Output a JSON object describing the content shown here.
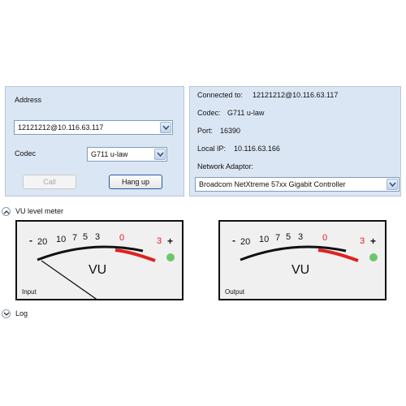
{
  "left_panel": {
    "address_label": "Address",
    "address_value": "12121212@10.116.63.117",
    "codec_label": "Codec",
    "codec_value": "G711 u-law",
    "call_button": "Call",
    "hangup_button": "Hang up"
  },
  "right_panel": {
    "connected_label": "Connected to:",
    "connected_value": "12121212@10.116.63.117",
    "codec_label": "Codec:",
    "codec_value": "G711 u-law",
    "port_label": "Port:",
    "port_value": "16390",
    "local_ip_label": "Local IP:",
    "local_ip_value": "10.116.63.166",
    "adaptor_label": "Network Adaptor:",
    "adaptor_value": "Broadcom NetXtreme 57xx Gigabit Controller"
  },
  "vu_section": {
    "title": "VU level meter",
    "meters": [
      {
        "name": "Input",
        "level_db": -20
      },
      {
        "name": "Output",
        "level_db": -20
      }
    ],
    "scale_labels": [
      "-",
      "20",
      "10",
      "7",
      "5",
      "3",
      "0",
      "3",
      "+"
    ],
    "unit": "VU",
    "indicator_color": "#6cc76c",
    "red_zone_color": "#e02020"
  },
  "log_section": {
    "title": "Log"
  }
}
